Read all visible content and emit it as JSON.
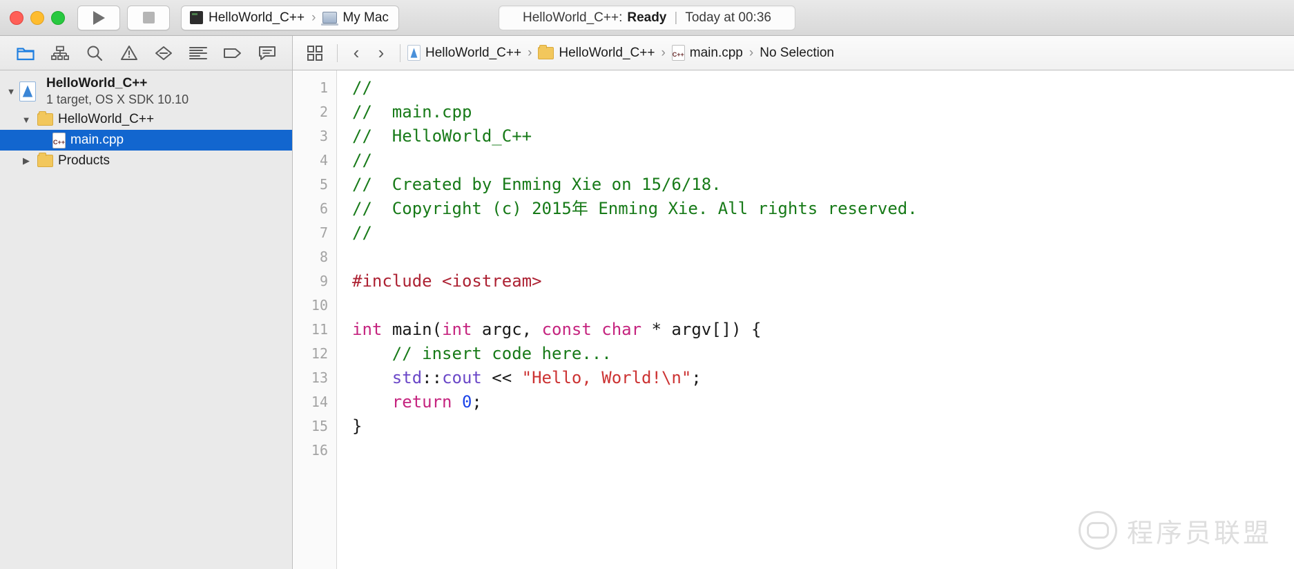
{
  "window": {
    "traffic_lights": [
      "close",
      "minimize",
      "zoom"
    ],
    "run_button": "run",
    "stop_button": "stop",
    "scheme": {
      "target": "HelloWorld_C++",
      "separator": "›",
      "destination": "My Mac"
    },
    "status": {
      "project": "HelloWorld_C++:",
      "state": "Ready",
      "divider": "|",
      "time": "Today at 00:36"
    }
  },
  "navigator_toolbar": {
    "icons": [
      {
        "name": "folder-icon",
        "label": "Project navigator",
        "active": true
      },
      {
        "name": "hierarchy-icon",
        "label": "Symbol navigator",
        "active": false
      },
      {
        "name": "search-icon",
        "label": "Find navigator",
        "active": false
      },
      {
        "name": "warning-icon",
        "label": "Issue navigator",
        "active": false
      },
      {
        "name": "test-icon",
        "label": "Test navigator",
        "active": false
      },
      {
        "name": "debug-icon",
        "label": "Debug navigator",
        "active": false
      },
      {
        "name": "breakpoint-icon",
        "label": "Breakpoint navigator",
        "active": false
      },
      {
        "name": "report-icon",
        "label": "Report navigator",
        "active": false
      }
    ]
  },
  "jumpbar": {
    "related-files-icon": "related-files",
    "back_arrow": "‹",
    "forward_arrow": "›",
    "breadcrumbs": [
      {
        "icon": "xcodeproj-icon",
        "label": "HelloWorld_C++"
      },
      {
        "icon": "folder-icon",
        "label": "HelloWorld_C++"
      },
      {
        "icon": "cpp-file-icon",
        "label": "main.cpp"
      },
      {
        "icon": null,
        "label": "No Selection"
      }
    ],
    "separator": "›"
  },
  "navigator": {
    "tree": [
      {
        "name": "HelloWorld_C++",
        "subtitle": "1 target, OS X SDK 10.10",
        "icon": "xcodeproj-icon",
        "disclosure": "open",
        "indent": 0,
        "selected": false
      },
      {
        "name": "HelloWorld_C++",
        "subtitle": "",
        "icon": "folder-icon",
        "disclosure": "open",
        "indent": 1,
        "selected": false
      },
      {
        "name": "main.cpp",
        "subtitle": "",
        "icon": "cpp-file-icon",
        "disclosure": "none",
        "indent": 2,
        "selected": true
      },
      {
        "name": "Products",
        "subtitle": "",
        "icon": "folder-icon",
        "disclosure": "closed",
        "indent": 1,
        "selected": false
      }
    ]
  },
  "editor": {
    "language": "cpp",
    "line_numbers": [
      1,
      2,
      3,
      4,
      5,
      6,
      7,
      8,
      9,
      10,
      11,
      12,
      13,
      14,
      15,
      16
    ],
    "lines": [
      {
        "n": 1,
        "tokens": [
          {
            "t": "//",
            "c": "comment"
          }
        ]
      },
      {
        "n": 2,
        "tokens": [
          {
            "t": "//  main.cpp",
            "c": "comment"
          }
        ]
      },
      {
        "n": 3,
        "tokens": [
          {
            "t": "//  HelloWorld_C++",
            "c": "comment"
          }
        ]
      },
      {
        "n": 4,
        "tokens": [
          {
            "t": "//",
            "c": "comment"
          }
        ]
      },
      {
        "n": 5,
        "tokens": [
          {
            "t": "//  Created by Enming Xie on 15/6/18.",
            "c": "comment"
          }
        ]
      },
      {
        "n": 6,
        "tokens": [
          {
            "t": "//  Copyright (c) 2015年 Enming Xie. All rights reserved.",
            "c": "comment"
          }
        ]
      },
      {
        "n": 7,
        "tokens": [
          {
            "t": "//",
            "c": "comment"
          }
        ]
      },
      {
        "n": 8,
        "tokens": []
      },
      {
        "n": 9,
        "tokens": [
          {
            "t": "#include <iostream>",
            "c": "pre"
          }
        ]
      },
      {
        "n": 10,
        "tokens": []
      },
      {
        "n": 11,
        "tokens": [
          {
            "t": "int",
            "c": "kw"
          },
          {
            "t": " ",
            "c": "plain"
          },
          {
            "t": "main",
            "c": "plain"
          },
          {
            "t": "(",
            "c": "plain"
          },
          {
            "t": "int",
            "c": "kw"
          },
          {
            "t": " argc, ",
            "c": "plain"
          },
          {
            "t": "const",
            "c": "kw"
          },
          {
            "t": " ",
            "c": "plain"
          },
          {
            "t": "char",
            "c": "kw"
          },
          {
            "t": " * argv[]) {",
            "c": "plain"
          }
        ]
      },
      {
        "n": 12,
        "tokens": [
          {
            "t": "    // insert code here...",
            "c": "comment"
          }
        ]
      },
      {
        "n": 13,
        "tokens": [
          {
            "t": "    ",
            "c": "plain"
          },
          {
            "t": "std",
            "c": "ns"
          },
          {
            "t": "::",
            "c": "plain"
          },
          {
            "t": "cout",
            "c": "ns"
          },
          {
            "t": " << ",
            "c": "plain"
          },
          {
            "t": "\"Hello, World!\\n\"",
            "c": "str"
          },
          {
            "t": ";",
            "c": "plain"
          }
        ]
      },
      {
        "n": 14,
        "tokens": [
          {
            "t": "    ",
            "c": "plain"
          },
          {
            "t": "return",
            "c": "kw"
          },
          {
            "t": " ",
            "c": "plain"
          },
          {
            "t": "0",
            "c": "num"
          },
          {
            "t": ";",
            "c": "plain"
          }
        ]
      },
      {
        "n": 15,
        "tokens": [
          {
            "t": "}",
            "c": "plain"
          }
        ]
      },
      {
        "n": 16,
        "tokens": []
      }
    ]
  },
  "watermark": {
    "text": "程序员联盟",
    "icon": "wechat-icon"
  },
  "colors": {
    "comment": "#177a18",
    "preprocessor": "#ad2233",
    "keyword": "#c5247f",
    "string": "#cc3333",
    "namespace": "#6b48c8",
    "number": "#1c44e8",
    "selection": "#1266cf",
    "accent_blue": "#3b86d6"
  }
}
